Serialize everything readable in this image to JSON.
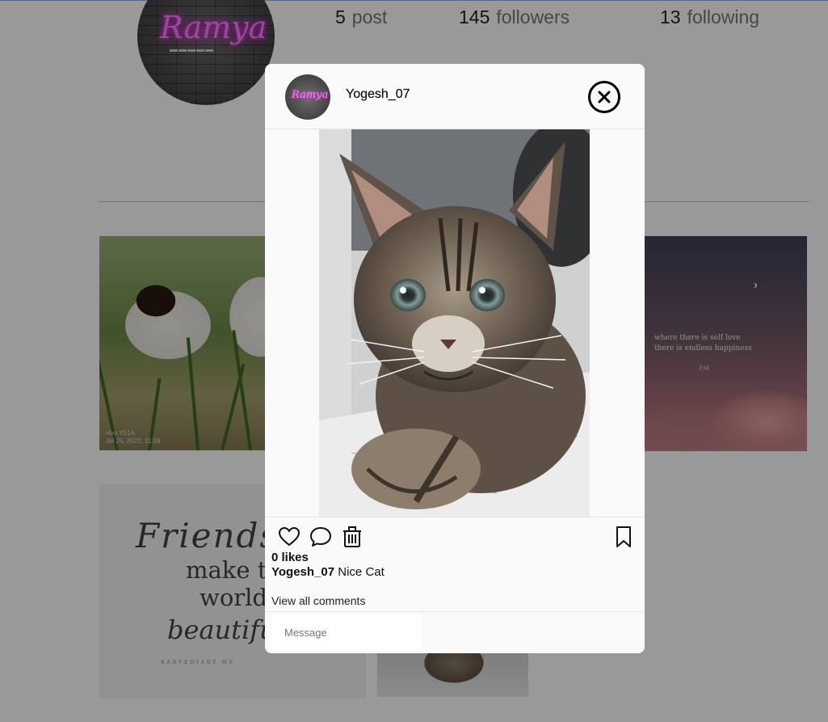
{
  "profile": {
    "avatar_label": "Ramya",
    "stats": [
      {
        "number": "5",
        "label": "post"
      },
      {
        "number": "145",
        "label": "followers"
      },
      {
        "number": "13",
        "label": "following"
      }
    ]
  },
  "grid": {
    "tiles": [
      {
        "name": "guinea-pigs-photo",
        "stamp": "vivo Y51A\nJul 25, 2022, 11:09"
      },
      {
        "name": "sky-quote-photo",
        "quote": "where there is self love\nthere is endless happiness",
        "sign": "P.M"
      },
      {
        "name": "friends-quote-photo",
        "lines": [
          "Friends",
          "make th",
          "world",
          "beautiful."
        ],
        "credit": "BABYEDIARY-ME"
      },
      {
        "name": "cat-thumbnail-photo"
      }
    ]
  },
  "modal": {
    "username": "Yogesh_07",
    "photo_alt": "kitten photo",
    "likes": "0 likes",
    "caption_user": "Yogesh_07",
    "caption_text": "Nice Cat",
    "view_comments": "View all comments",
    "comment_placeholder": "Message",
    "icons": [
      "close-icon",
      "heart-icon",
      "comment-icon",
      "trash-icon",
      "bookmark-icon"
    ]
  },
  "colors": {
    "overlay": "rgba(0,0,0,0.40)",
    "modal_bg": "#fafafa",
    "neon": "#ff7bff"
  }
}
